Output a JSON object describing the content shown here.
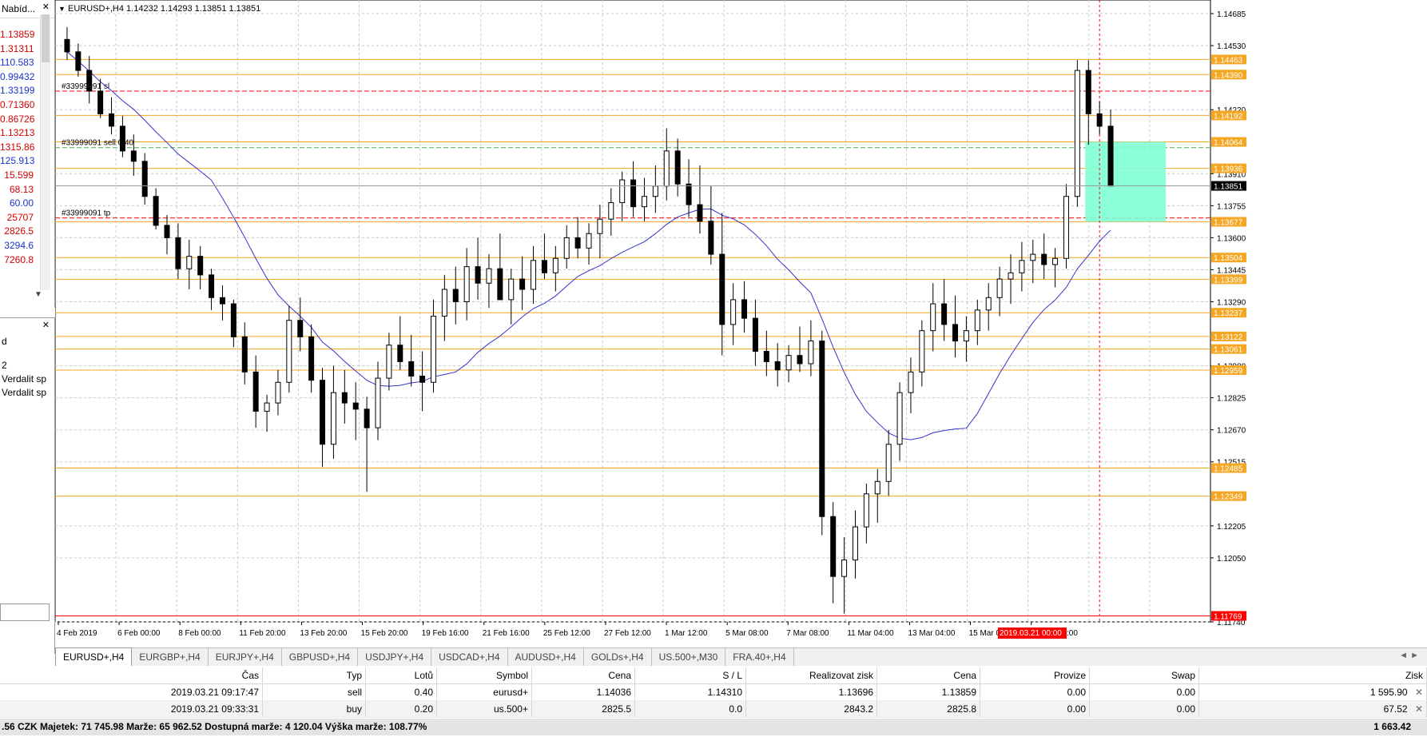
{
  "chart": {
    "header": "EURUSD+,H4  1.14232 1.14293 1.13851 1.13851",
    "price_min": 1.1174,
    "price_max": 1.1472,
    "price_ticks": [
      "1.14685",
      "1.14530",
      "1.14220",
      "1.13910",
      "1.13755",
      "1.13600",
      "1.13445",
      "1.13290",
      "1.12980",
      "1.12825",
      "1.12670",
      "1.12515",
      "1.12205",
      "1.12050",
      "1.11740"
    ],
    "level_lines": [
      {
        "price": 1.14463,
        "label": "1.14463",
        "color": "#f5a623"
      },
      {
        "price": 1.1439,
        "label": "1.14390",
        "color": "#f5a623"
      },
      {
        "price": 1.14192,
        "label": "1.14192",
        "color": "#f5a623"
      },
      {
        "price": 1.14064,
        "label": "1.14064",
        "color": "#f5a623"
      },
      {
        "price": 1.13936,
        "label": "1.13936",
        "color": "#f5a623"
      },
      {
        "price": 1.13677,
        "label": "1.13677",
        "color": "#f5a623"
      },
      {
        "price": 1.13504,
        "label": "1.13504",
        "color": "#f5a623"
      },
      {
        "price": 1.13399,
        "label": "1.13399",
        "color": "#f5a623"
      },
      {
        "price": 1.13237,
        "label": "1.13237",
        "color": "#f5a623"
      },
      {
        "price": 1.13122,
        "label": "1.13122",
        "color": "#f5a623"
      },
      {
        "price": 1.13061,
        "label": "1.13061",
        "color": "#f5a623"
      },
      {
        "price": 1.12959,
        "label": "1.12959",
        "color": "#f5a623"
      },
      {
        "price": 1.12485,
        "label": "1.12485",
        "color": "#f5a623"
      },
      {
        "price": 1.12349,
        "label": "1.12349",
        "color": "#f5a623"
      },
      {
        "price": 1.11769,
        "label": "1.11769",
        "color": "#ff0000"
      }
    ],
    "current_price": {
      "price": 1.13851,
      "label": "1.13851"
    },
    "order_labels": [
      {
        "text": "#33999091 sl",
        "price": 1.1431,
        "color": "#ff0000"
      },
      {
        "text": "#33999091 sell 0.40",
        "price": 1.14036,
        "color": "#4caf50"
      },
      {
        "text": "#33999091 tp",
        "price": 1.13696,
        "color": "#ff0000"
      }
    ],
    "time_labels": [
      "4 Feb 2019",
      "6 Feb 00:00",
      "8 Feb 00:00",
      "11 Feb 20:00",
      "13 Feb 20:00",
      "15 Feb 20:00",
      "19 Feb 16:00",
      "21 Feb 16:00",
      "25 Feb 12:00",
      "27 Feb 12:00",
      "1 Mar 12:00",
      "5 Mar 08:00",
      "7 Mar 08:00",
      "11 Mar 04:00",
      "13 Mar 04:00",
      "15 Mar 04:00",
      "19 Mar"
    ],
    "time_highlight": "2019.03.21 00:00",
    "time_highlight_tail": ":00",
    "rect_color": "#7fffd4",
    "ma_color": "#3333cc",
    "candles": [
      [
        1.1456,
        1.1462,
        1.1446,
        1.145
      ],
      [
        1.145,
        1.1454,
        1.1438,
        1.1441
      ],
      [
        1.1441,
        1.1448,
        1.1425,
        1.1431
      ],
      [
        1.1431,
        1.1437,
        1.1418,
        1.142
      ],
      [
        1.142,
        1.1428,
        1.141,
        1.1414
      ],
      [
        1.1414,
        1.1419,
        1.1399,
        1.1402
      ],
      [
        1.1402,
        1.141,
        1.139,
        1.1397
      ],
      [
        1.1397,
        1.1401,
        1.1376,
        1.138
      ],
      [
        1.138,
        1.1384,
        1.1364,
        1.1366
      ],
      [
        1.1366,
        1.1371,
        1.1352,
        1.136
      ],
      [
        1.136,
        1.1367,
        1.134,
        1.1345
      ],
      [
        1.1345,
        1.1359,
        1.1335,
        1.1351
      ],
      [
        1.1351,
        1.1356,
        1.1335,
        1.1342
      ],
      [
        1.1342,
        1.1345,
        1.1325,
        1.1331
      ],
      [
        1.1331,
        1.1337,
        1.132,
        1.1328
      ],
      [
        1.1328,
        1.133,
        1.1307,
        1.1312
      ],
      [
        1.1312,
        1.1319,
        1.1289,
        1.1295
      ],
      [
        1.1295,
        1.1303,
        1.1268,
        1.1276
      ],
      [
        1.1276,
        1.1284,
        1.1266,
        1.128
      ],
      [
        1.128,
        1.1296,
        1.1274,
        1.129
      ],
      [
        1.129,
        1.1327,
        1.1285,
        1.132
      ],
      [
        1.132,
        1.1331,
        1.1305,
        1.1312
      ],
      [
        1.1312,
        1.1318,
        1.1285,
        1.1291
      ],
      [
        1.1291,
        1.1297,
        1.1249,
        1.126
      ],
      [
        1.126,
        1.1298,
        1.1253,
        1.1285
      ],
      [
        1.1285,
        1.1296,
        1.127,
        1.128
      ],
      [
        1.128,
        1.129,
        1.1262,
        1.1277
      ],
      [
        1.1277,
        1.1283,
        1.1237,
        1.1268
      ],
      [
        1.1268,
        1.13,
        1.1262,
        1.1292
      ],
      [
        1.1292,
        1.1314,
        1.1286,
        1.1308
      ],
      [
        1.1308,
        1.1322,
        1.1296,
        1.13
      ],
      [
        1.13,
        1.1313,
        1.1288,
        1.1293
      ],
      [
        1.1293,
        1.1305,
        1.1276,
        1.129
      ],
      [
        1.129,
        1.133,
        1.1285,
        1.1322
      ],
      [
        1.1322,
        1.1342,
        1.131,
        1.1335
      ],
      [
        1.1335,
        1.1346,
        1.1318,
        1.1329
      ],
      [
        1.1329,
        1.1355,
        1.132,
        1.1346
      ],
      [
        1.1346,
        1.136,
        1.133,
        1.1338
      ],
      [
        1.1338,
        1.1352,
        1.1326,
        1.1345
      ],
      [
        1.1345,
        1.1362,
        1.1336,
        1.133
      ],
      [
        1.133,
        1.1345,
        1.1318,
        1.134
      ],
      [
        1.134,
        1.1351,
        1.1325,
        1.1335
      ],
      [
        1.1335,
        1.1356,
        1.1328,
        1.1349
      ],
      [
        1.1349,
        1.1362,
        1.134,
        1.1343
      ],
      [
        1.1343,
        1.1356,
        1.1334,
        1.135
      ],
      [
        1.135,
        1.1366,
        1.1345,
        1.136
      ],
      [
        1.136,
        1.137,
        1.135,
        1.1355
      ],
      [
        1.1355,
        1.1367,
        1.1347,
        1.1362
      ],
      [
        1.1362,
        1.1376,
        1.135,
        1.1369
      ],
      [
        1.1369,
        1.1384,
        1.1361,
        1.1377
      ],
      [
        1.1377,
        1.1392,
        1.1368,
        1.1388
      ],
      [
        1.1388,
        1.1397,
        1.137,
        1.1375
      ],
      [
        1.1375,
        1.1389,
        1.1368,
        1.138
      ],
      [
        1.138,
        1.1395,
        1.1372,
        1.1385
      ],
      [
        1.1385,
        1.1413,
        1.1378,
        1.1402
      ],
      [
        1.1402,
        1.1408,
        1.138,
        1.1386
      ],
      [
        1.1386,
        1.1398,
        1.137,
        1.1376
      ],
      [
        1.1376,
        1.1395,
        1.1362,
        1.1368
      ],
      [
        1.1368,
        1.1385,
        1.1347,
        1.1352
      ],
      [
        1.1352,
        1.1372,
        1.1303,
        1.1318
      ],
      [
        1.1318,
        1.1338,
        1.1308,
        1.133
      ],
      [
        1.133,
        1.1339,
        1.1314,
        1.1321
      ],
      [
        1.1321,
        1.133,
        1.1298,
        1.1305
      ],
      [
        1.1305,
        1.1315,
        1.1293,
        1.13
      ],
      [
        1.13,
        1.1309,
        1.1288,
        1.1296
      ],
      [
        1.1296,
        1.1308,
        1.129,
        1.1303
      ],
      [
        1.1303,
        1.1317,
        1.1295,
        1.1299
      ],
      [
        1.1299,
        1.132,
        1.1293,
        1.131
      ],
      [
        1.131,
        1.1315,
        1.1216,
        1.1225
      ],
      [
        1.1225,
        1.1232,
        1.1183,
        1.1196
      ],
      [
        1.1196,
        1.1215,
        1.1178,
        1.1204
      ],
      [
        1.1204,
        1.1228,
        1.1195,
        1.122
      ],
      [
        1.122,
        1.1241,
        1.1212,
        1.1236
      ],
      [
        1.1236,
        1.1248,
        1.1222,
        1.1242
      ],
      [
        1.1242,
        1.1267,
        1.1235,
        1.126
      ],
      [
        1.126,
        1.129,
        1.1252,
        1.1285
      ],
      [
        1.1285,
        1.1302,
        1.1275,
        1.1295
      ],
      [
        1.1295,
        1.132,
        1.1288,
        1.1315
      ],
      [
        1.1315,
        1.1338,
        1.1305,
        1.1328
      ],
      [
        1.1328,
        1.134,
        1.131,
        1.1318
      ],
      [
        1.1318,
        1.1332,
        1.1302,
        1.131
      ],
      [
        1.131,
        1.1322,
        1.13,
        1.1315
      ],
      [
        1.1315,
        1.133,
        1.1308,
        1.1325
      ],
      [
        1.1325,
        1.1338,
        1.1315,
        1.1331
      ],
      [
        1.1331,
        1.1346,
        1.1322,
        1.134
      ],
      [
        1.134,
        1.1352,
        1.1328,
        1.1343
      ],
      [
        1.1343,
        1.1358,
        1.1334,
        1.1349
      ],
      [
        1.1349,
        1.1359,
        1.1338,
        1.1352
      ],
      [
        1.1352,
        1.1362,
        1.134,
        1.1347
      ],
      [
        1.1347,
        1.1355,
        1.1336,
        1.135
      ],
      [
        1.135,
        1.1386,
        1.1345,
        1.138
      ],
      [
        1.138,
        1.1446,
        1.1375,
        1.1441
      ],
      [
        1.1441,
        1.1446,
        1.1405,
        1.142
      ],
      [
        1.142,
        1.1426,
        1.141,
        1.1414
      ],
      [
        1.1414,
        1.1422,
        1.1385,
        1.1385
      ]
    ]
  },
  "market_watch": {
    "header": "Nabíd...",
    "prices": [
      {
        "text": "1.13859",
        "color": "#d40000"
      },
      {
        "text": "1.31311",
        "color": "#d40000"
      },
      {
        "text": "110.583",
        "color": "#1a33cc"
      },
      {
        "text": "0.99432",
        "color": "#1a33cc"
      },
      {
        "text": "1.33199",
        "color": "#1a33cc"
      },
      {
        "text": "0.71360",
        "color": "#d40000"
      },
      {
        "text": "0.86726",
        "color": "#d40000"
      },
      {
        "text": "1.13213",
        "color": "#d40000"
      },
      {
        "text": "1315.86",
        "color": "#d40000"
      },
      {
        "text": "125.913",
        "color": "#1a33cc"
      },
      {
        "text": "15.599",
        "color": "#d40000"
      },
      {
        "text": "68.13",
        "color": "#d40000"
      },
      {
        "text": "60.00",
        "color": "#1a33cc"
      },
      {
        "text": "25707",
        "color": "#d40000"
      },
      {
        "text": "2826.5",
        "color": "#d40000"
      },
      {
        "text": "3294.6",
        "color": "#1a33cc"
      },
      {
        "text": "7260.8",
        "color": "#d40000"
      }
    ]
  },
  "navigator": {
    "items": [
      "d",
      "2",
      "Verdalit sp",
      "Verdalit sp"
    ]
  },
  "tabs": [
    "EURUSD+,H4",
    "EURGBP+,H4",
    "EURJPY+,H4",
    "GBPUSD+,H4",
    "USDJPY+,H4",
    "USDCAD+,H4",
    "AUDUSD+,H4",
    "GOLDs+,H4",
    "US.500+,M30",
    "FRA.40+,H4"
  ],
  "terminal": {
    "columns": [
      "Čas",
      "Typ",
      "Lotů",
      "Symbol",
      "Cena",
      "S / L",
      "Realizovat zisk",
      "Cena",
      "Provize",
      "Swap",
      "Zisk"
    ],
    "rows": [
      [
        "2019.03.21 09:17:47",
        "sell",
        "0.40",
        "eurusd+",
        "1.14036",
        "1.14310",
        "1.13696",
        "1.13859",
        "0.00",
        "0.00",
        "1 595.90"
      ],
      [
        "2019.03.21 09:33:31",
        "buy",
        "0.20",
        "us.500+",
        "2825.5",
        "0.0",
        "2843.2",
        "2825.8",
        "0.00",
        "0.00",
        "67.52"
      ]
    ],
    "balance_text": ".56 CZK  Majetek: 71 745.98  Marže: 65 962.52  Dostupná marže: 4 120.04  Výška marže: 108.77%",
    "total_profit": "1 663.42"
  }
}
